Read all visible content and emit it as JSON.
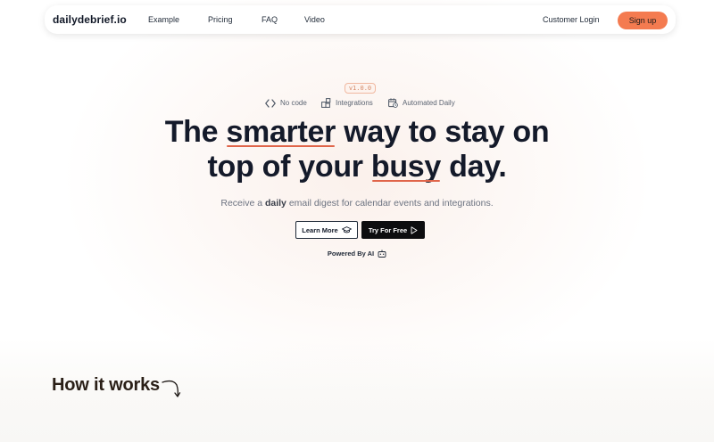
{
  "navbar": {
    "brand": "dailydebrief.io",
    "links": [
      "Example",
      "Pricing",
      "FAQ",
      "Video"
    ],
    "login_label": "Customer Login",
    "signup_label": "Sign up"
  },
  "hero": {
    "version": "v1.0.0",
    "features": [
      {
        "label": "No code",
        "icon": "code-brackets-icon"
      },
      {
        "label": "Integrations",
        "icon": "puzzle-blocks-icon"
      },
      {
        "label": "Automated Daily",
        "icon": "calendar-clock-icon"
      }
    ],
    "headline_line1": {
      "pre": "The ",
      "highlight": "smarter",
      "post": " way to stay on"
    },
    "headline_line2": {
      "pre": "top of your ",
      "highlight": "busy",
      "post": " day."
    },
    "subtitle": {
      "pre": "Receive a ",
      "bold": "daily",
      "post": " email digest for calendar events and integrations."
    },
    "learn_more_label": "Learn More",
    "try_free_label": "Try For Free",
    "powered_label": "Powered By AI"
  },
  "how_it_works": {
    "title": "How it works"
  },
  "colors": {
    "accent": "#f47b50",
    "underline": "#e0654a",
    "text_dark": "#141a2a"
  }
}
